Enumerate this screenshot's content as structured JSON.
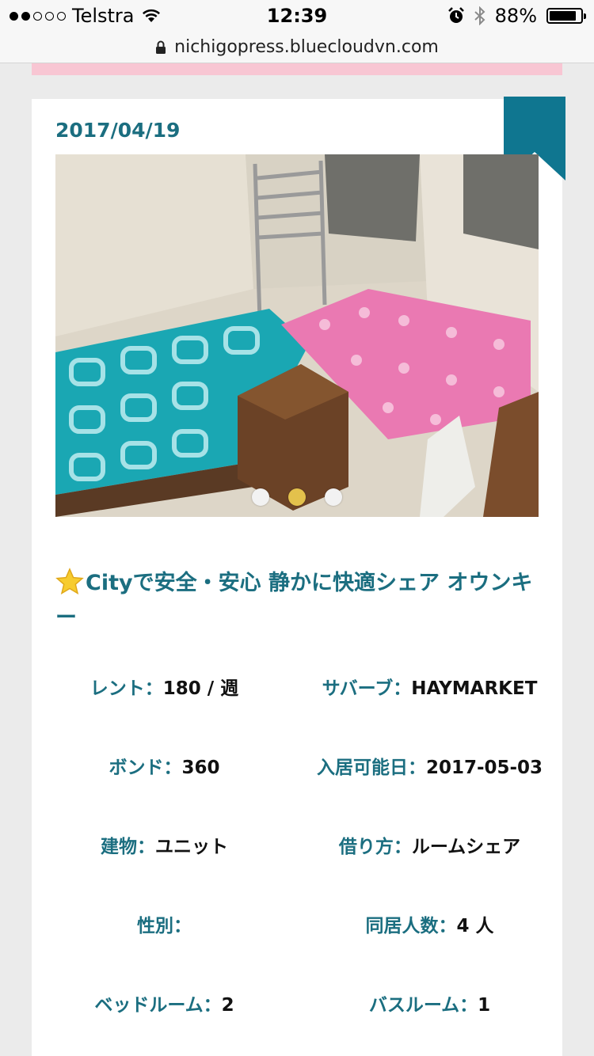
{
  "status": {
    "carrier": "Telstra",
    "time": "12:39",
    "battery": "88%",
    "battery_level": 0.88
  },
  "browser": {
    "url": "nichigopress.bluecloudvn.com"
  },
  "listing": {
    "date": "2017/04/19",
    "title": "Cityで安全・安心 静かに快適シェア オウンキー",
    "slider": {
      "count": 3,
      "active_index": 1
    },
    "colors": {
      "accent": "#1b6e80",
      "slider_active": "#e3c14c",
      "top_band": "#f8c6d3"
    },
    "specs": [
      {
        "label": "レント：",
        "value": "180 / 週"
      },
      {
        "label": "サバーブ：",
        "value": "HAYMARKET"
      },
      {
        "label": "ボンド：",
        "value": "360"
      },
      {
        "label": "入居可能日：",
        "value": "2017-05-03"
      },
      {
        "label": "建物：",
        "value": "ユニット"
      },
      {
        "label": "借り方：",
        "value": "ルームシェア"
      },
      {
        "label": "性別：",
        "value": ""
      },
      {
        "label": "同居人数：",
        "value": "4 人"
      },
      {
        "label": "ベッドルーム：",
        "value": "2"
      },
      {
        "label": "バスルーム：",
        "value": "1"
      }
    ]
  }
}
